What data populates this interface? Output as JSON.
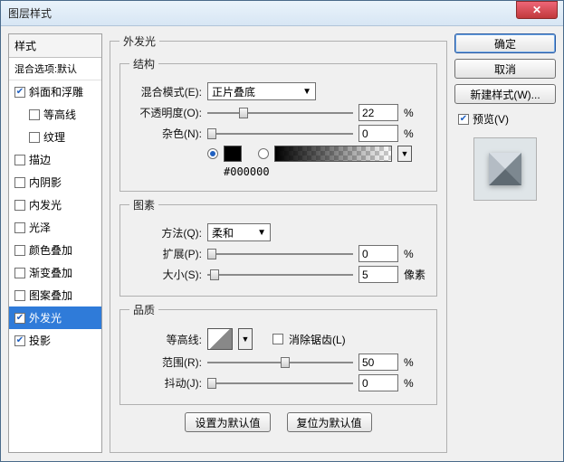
{
  "window": {
    "title": "图层样式"
  },
  "styles_panel": {
    "header": "样式",
    "sub": "混合选项:默认",
    "items": [
      {
        "label": "斜面和浮雕",
        "checked": true,
        "indent": false
      },
      {
        "label": "等高线",
        "checked": false,
        "indent": true
      },
      {
        "label": "纹理",
        "checked": false,
        "indent": true
      },
      {
        "label": "描边",
        "checked": false,
        "indent": false
      },
      {
        "label": "内阴影",
        "checked": false,
        "indent": false
      },
      {
        "label": "内发光",
        "checked": false,
        "indent": false
      },
      {
        "label": "光泽",
        "checked": false,
        "indent": false
      },
      {
        "label": "颜色叠加",
        "checked": false,
        "indent": false
      },
      {
        "label": "渐变叠加",
        "checked": false,
        "indent": false
      },
      {
        "label": "图案叠加",
        "checked": false,
        "indent": false
      },
      {
        "label": "外发光",
        "checked": true,
        "indent": false,
        "selected": true
      },
      {
        "label": "投影",
        "checked": true,
        "indent": false
      }
    ]
  },
  "outer_glow": {
    "legend": "外发光",
    "structure": {
      "legend": "结构",
      "blend_mode_label": "混合模式(E):",
      "blend_mode_value": "正片叠底",
      "opacity_label": "不透明度(O):",
      "opacity_value": "22",
      "opacity_unit": "%",
      "noise_label": "杂色(N):",
      "noise_value": "0",
      "noise_unit": "%",
      "color_hex": "#000000"
    },
    "elements": {
      "legend": "图素",
      "technique_label": "方法(Q):",
      "technique_value": "柔和",
      "spread_label": "扩展(P):",
      "spread_value": "0",
      "spread_unit": "%",
      "size_label": "大小(S):",
      "size_value": "5",
      "size_unit": "像素"
    },
    "quality": {
      "legend": "品质",
      "contour_label": "等高线:",
      "antialias_label": "消除锯齿(L)",
      "antialias_checked": false,
      "range_label": "范围(R):",
      "range_value": "50",
      "range_unit": "%",
      "jitter_label": "抖动(J):",
      "jitter_value": "0",
      "jitter_unit": "%"
    },
    "buttons": {
      "make_default": "设置为默认值",
      "reset_default": "复位为默认值"
    }
  },
  "right": {
    "ok": "确定",
    "cancel": "取消",
    "new_style": "新建样式(W)...",
    "preview_label": "预览(V)",
    "preview_checked": true
  }
}
